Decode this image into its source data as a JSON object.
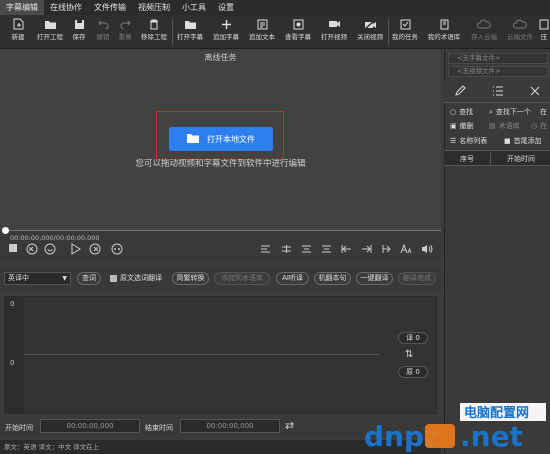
{
  "menu": [
    "字幕编辑",
    "在线协作",
    "文件传输",
    "视频压制",
    "小工具",
    "设置"
  ],
  "toolbar": [
    {
      "label": "新建",
      "icon": "new-file-icon",
      "enabled": true
    },
    {
      "label": "打开工程",
      "icon": "folder-open-icon",
      "enabled": true
    },
    {
      "label": "保存",
      "icon": "save-icon",
      "enabled": true
    },
    {
      "label": "撤销",
      "icon": "undo-icon",
      "enabled": false
    },
    {
      "label": "重做",
      "icon": "redo-icon",
      "enabled": false
    },
    {
      "label": "移除工程",
      "icon": "trash-icon",
      "enabled": true
    },
    {
      "label": "打开字幕",
      "icon": "folder-open-icon",
      "enabled": true
    },
    {
      "label": "追加字幕",
      "icon": "plus-icon",
      "enabled": true
    },
    {
      "label": "追加文本",
      "icon": "text-file-icon",
      "enabled": true
    },
    {
      "label": "查看字幕",
      "icon": "view-subtitle-icon",
      "enabled": true
    },
    {
      "label": "打开视频",
      "icon": "video-camera-icon",
      "enabled": true
    },
    {
      "label": "关闭视频",
      "icon": "video-off-icon",
      "enabled": true
    },
    {
      "label": "我的任务",
      "icon": "task-icon",
      "enabled": true
    },
    {
      "label": "我的术语库",
      "icon": "glossary-icon",
      "enabled": true
    },
    {
      "label": "存入云端",
      "icon": "cloud-upload-icon",
      "enabled": false
    },
    {
      "label": "云端文件",
      "icon": "cloud-file-icon",
      "enabled": false
    },
    {
      "label": "压",
      "icon": "compress-icon",
      "enabled": true
    }
  ],
  "preview": {
    "title": "离线任务",
    "open_button": "打开本地文件",
    "hint": "您可以拖动视频和字幕文件到软件中进行编辑",
    "timecode": "00:00:00,000/00:00:00,000"
  },
  "editbar": {
    "lang_select": "英译中",
    "query_button": "查词",
    "checkbox_label": "原文选词翻译",
    "buttons": [
      {
        "label": "简繁转换",
        "enabled": true
      },
      {
        "label": "添加到术语库",
        "enabled": false
      },
      {
        "label": "AI听译",
        "enabled": true
      },
      {
        "label": "机翻本句",
        "enabled": true
      },
      {
        "label": "一键翻译",
        "enabled": true
      },
      {
        "label": "翻译完成",
        "enabled": false
      }
    ]
  },
  "editor": {
    "line1": "0",
    "line2": "0",
    "translation_counter": "译 0",
    "source_counter": "原 0"
  },
  "timebar": {
    "start_label": "开始时间",
    "start_value": "00:00:00,000",
    "end_label": "结束时间",
    "end_value": "00:00:00,000"
  },
  "status": "原文：英语  译文：中文   译文在上",
  "right_panel": {
    "subtitle_file": "<无字幕文件>",
    "video_file": "<无视频文件>",
    "tools": [
      {
        "label": "查找",
        "enabled": true
      },
      {
        "label": "查找下一个",
        "enabled": true
      },
      {
        "label": "在",
        "enabled": true
      },
      {
        "label": "撤删",
        "enabled": true
      },
      {
        "label": "术语库",
        "enabled": false
      },
      {
        "label": "在",
        "enabled": false
      },
      {
        "label": "名称列表",
        "enabled": true
      },
      {
        "label": "首尾添加",
        "enabled": true
      }
    ],
    "columns": [
      "序号",
      "开始时间"
    ]
  },
  "watermark": {
    "site": "电脑配置网",
    "domain_a": "dnpz",
    "domain_b": ".net"
  },
  "colors": {
    "accent": "#2d7ff0",
    "highlight": "#d62b2b",
    "watermark_orange": "#f07b1a",
    "watermark_blue": "#1a73c8"
  }
}
